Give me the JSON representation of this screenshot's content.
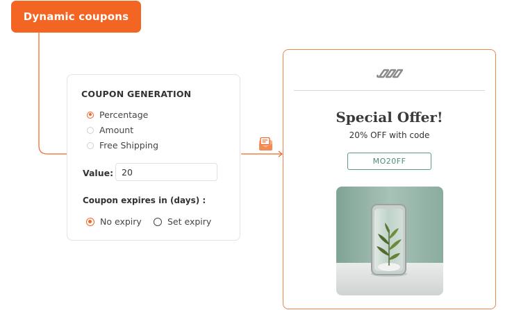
{
  "header": {
    "tag_label": "Dynamic coupons"
  },
  "coupon_form": {
    "title": "COUPON GENERATION",
    "types": [
      {
        "label": "Percentage",
        "selected": true
      },
      {
        "label": "Amount",
        "selected": false
      },
      {
        "label": "Free Shipping",
        "selected": false
      }
    ],
    "value_label": "Value:",
    "value": "20",
    "expiry_label": "Coupon expires in (days) :",
    "expiry_options": [
      {
        "label": "No expiry",
        "selected": true
      },
      {
        "label": "Set expiry",
        "selected": false
      }
    ]
  },
  "email_preview": {
    "title": "Special Offer!",
    "subtitle": "20% OFF with code",
    "code": "MO20FF"
  },
  "icons": {
    "connector_icon": "email-icon",
    "logo": "chain-link-logo"
  },
  "colors": {
    "accent": "#f26522",
    "code_teal": "#4b8d7b",
    "image_background": "#8fb1a3"
  }
}
